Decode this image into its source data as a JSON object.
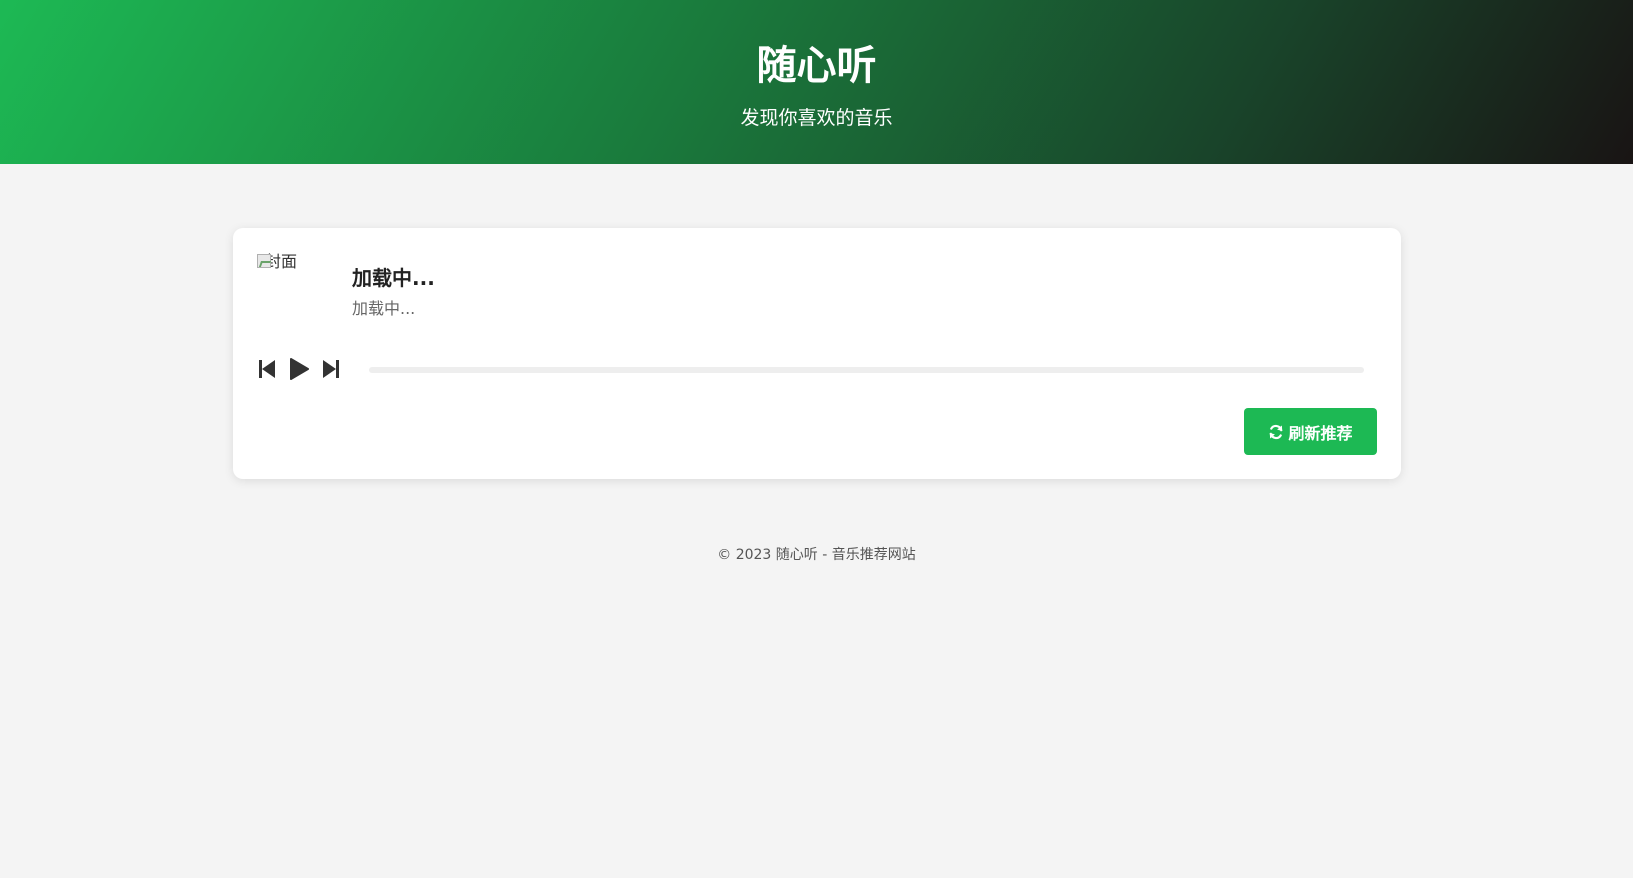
{
  "header": {
    "title": "随心听",
    "subtitle": "发现你喜欢的音乐"
  },
  "player": {
    "cover_alt": "封面",
    "song_title": "加载中...",
    "song_artist": "加载中...",
    "progress": 0,
    "controls": {
      "prev_icon": "skip-back-icon",
      "play_icon": "play-icon",
      "next_icon": "skip-forward-icon"
    },
    "refresh_icon": "refresh-icon",
    "refresh_label": "刷新推荐"
  },
  "footer": {
    "text": "© 2023 随心听 - 音乐推荐网站"
  },
  "colors": {
    "accent": "#1db954",
    "header_gradient_start": "#1db954",
    "header_gradient_end": "#191414",
    "page_background": "#f4f4f4",
    "card_background": "#ffffff",
    "control_icon": "#333333"
  }
}
